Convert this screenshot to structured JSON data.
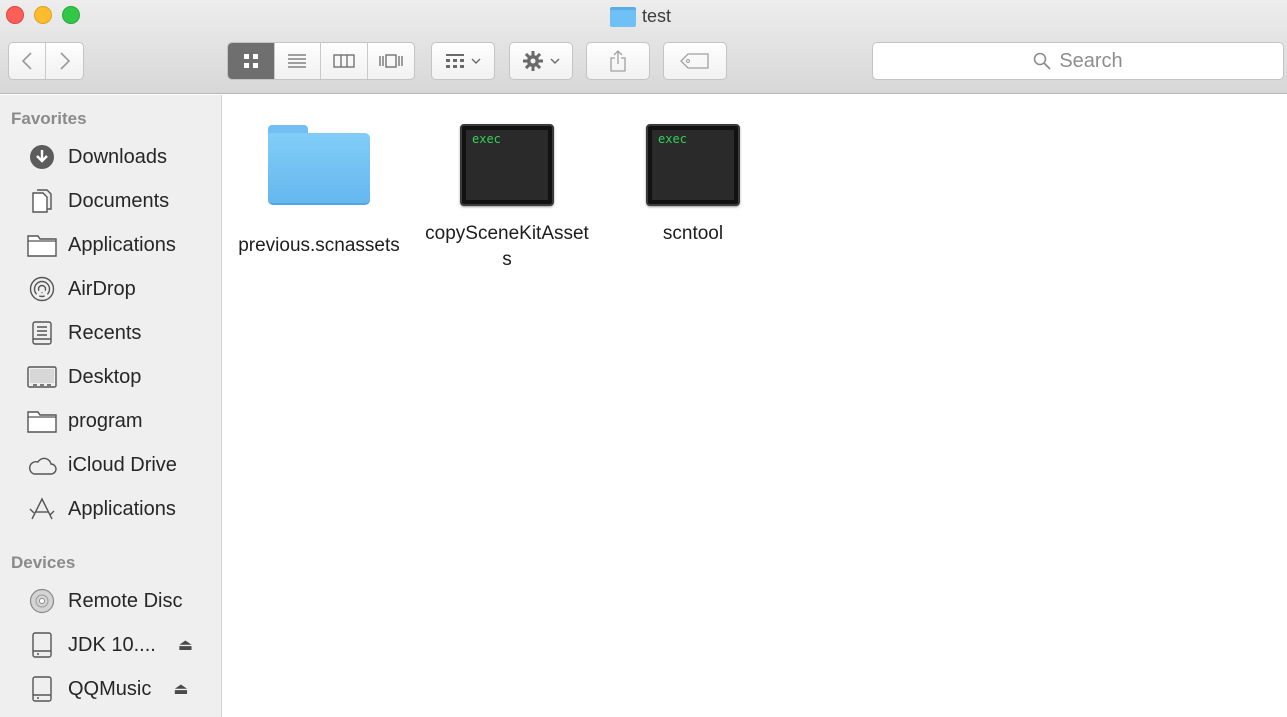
{
  "window": {
    "title": "test"
  },
  "toolbar": {
    "search_placeholder": "Search",
    "back_icon": "chevron-left-icon",
    "forward_icon": "chevron-right-icon"
  },
  "sidebar": {
    "favorites_heading": "Favorites",
    "favorites": [
      {
        "label": "Downloads",
        "icon": "download-icon"
      },
      {
        "label": "Documents",
        "icon": "documents-icon"
      },
      {
        "label": "Applications",
        "icon": "folder-icon"
      },
      {
        "label": "AirDrop",
        "icon": "airdrop-icon"
      },
      {
        "label": "Recents",
        "icon": "recents-icon"
      },
      {
        "label": "Desktop",
        "icon": "desktop-icon"
      },
      {
        "label": "program",
        "icon": "folder-icon"
      },
      {
        "label": "iCloud Drive",
        "icon": "cloud-icon"
      },
      {
        "label": "Applications",
        "icon": "applications-icon"
      }
    ],
    "devices_heading": "Devices",
    "devices": [
      {
        "label": "Remote Disc",
        "icon": "disc-icon"
      },
      {
        "label": "JDK 10....",
        "icon": "drive-icon",
        "eject": "⏏"
      },
      {
        "label": "QQMusic",
        "icon": "drive-icon",
        "eject": "⏏"
      }
    ]
  },
  "files": [
    {
      "name": "previous.scnassets",
      "kind": "folder"
    },
    {
      "name": "copySceneKitAssets",
      "kind": "exec",
      "badge": "exec"
    },
    {
      "name": "scntool",
      "kind": "exec",
      "badge": "exec"
    }
  ],
  "colors": {
    "folder_blue": "#6ec0f5",
    "exec_green": "#33d05a",
    "close": "#fc5f57",
    "minimize": "#fdbc2e",
    "maximize": "#33c748"
  }
}
